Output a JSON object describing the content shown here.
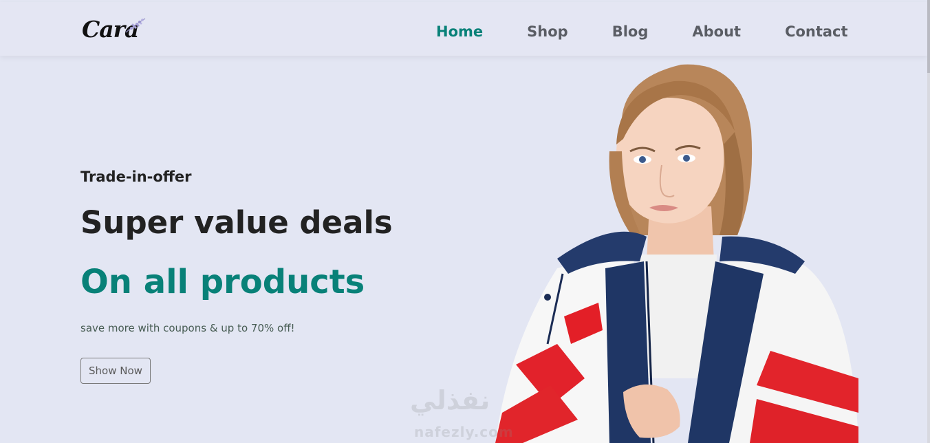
{
  "header": {
    "logo_text": "Cara",
    "nav": [
      {
        "label": "Home",
        "active": true
      },
      {
        "label": "Shop",
        "active": false
      },
      {
        "label": "Blog",
        "active": false
      },
      {
        "label": "About",
        "active": false
      },
      {
        "label": "Contact",
        "active": false
      }
    ]
  },
  "hero": {
    "subtitle": "Trade-in-offer",
    "headline": "Super value deals",
    "headline_accent": "On all products",
    "promo": "save more with coupons & up to 70% off!",
    "cta_label": "Show Now"
  },
  "watermark": {
    "arabic": "نفذلي",
    "latin": "nafezly.com"
  },
  "colors": {
    "background": "#e3e6f3",
    "accent": "#088178",
    "text_dark": "#222222",
    "nav_text": "#5a5d64"
  }
}
